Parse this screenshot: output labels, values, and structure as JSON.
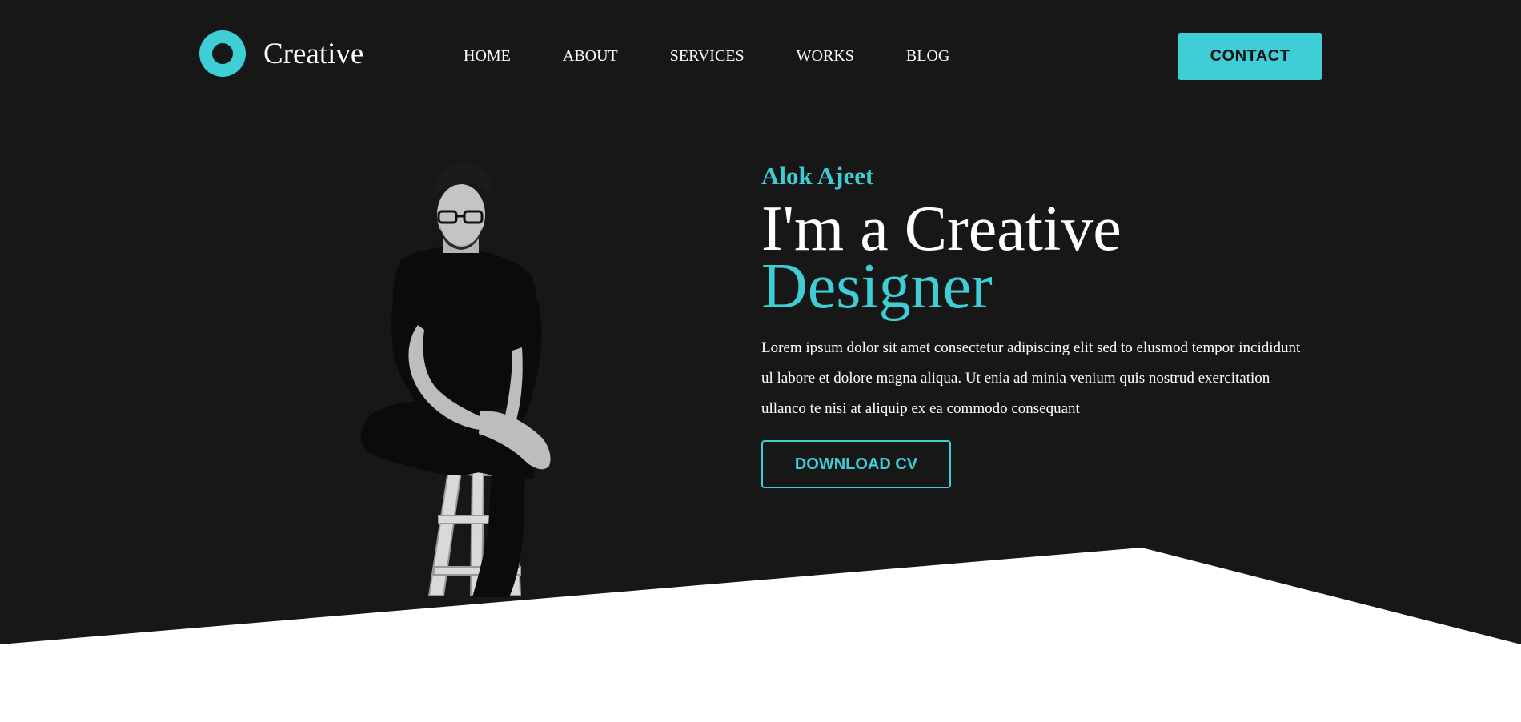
{
  "brand": {
    "name": "Creative",
    "logo_icon": "ring-logo-icon",
    "accent_color": "#3ecfd6",
    "background_color": "#171718"
  },
  "nav": {
    "items": [
      {
        "label": "HOME"
      },
      {
        "label": "ABOUT"
      },
      {
        "label": "SERVICES"
      },
      {
        "label": "WORKS"
      },
      {
        "label": "BLOG"
      }
    ],
    "cta_label": "CONTACT"
  },
  "hero": {
    "name": "Alok Ajeet",
    "headline_line1": "I'm a Creative",
    "headline_line2": "Designer",
    "description": "Lorem ipsum dolor sit amet consectetur adipiscing elit sed to elusmod tempor incididunt ul labore et dolore magna aliqua. Ut enia ad minia venium quis nostrud exercitation ullanco te nisi at aliquip ex ea commodo consequant",
    "cv_button_label": "DOWNLOAD CV",
    "portrait_icon": "portrait-photo"
  }
}
